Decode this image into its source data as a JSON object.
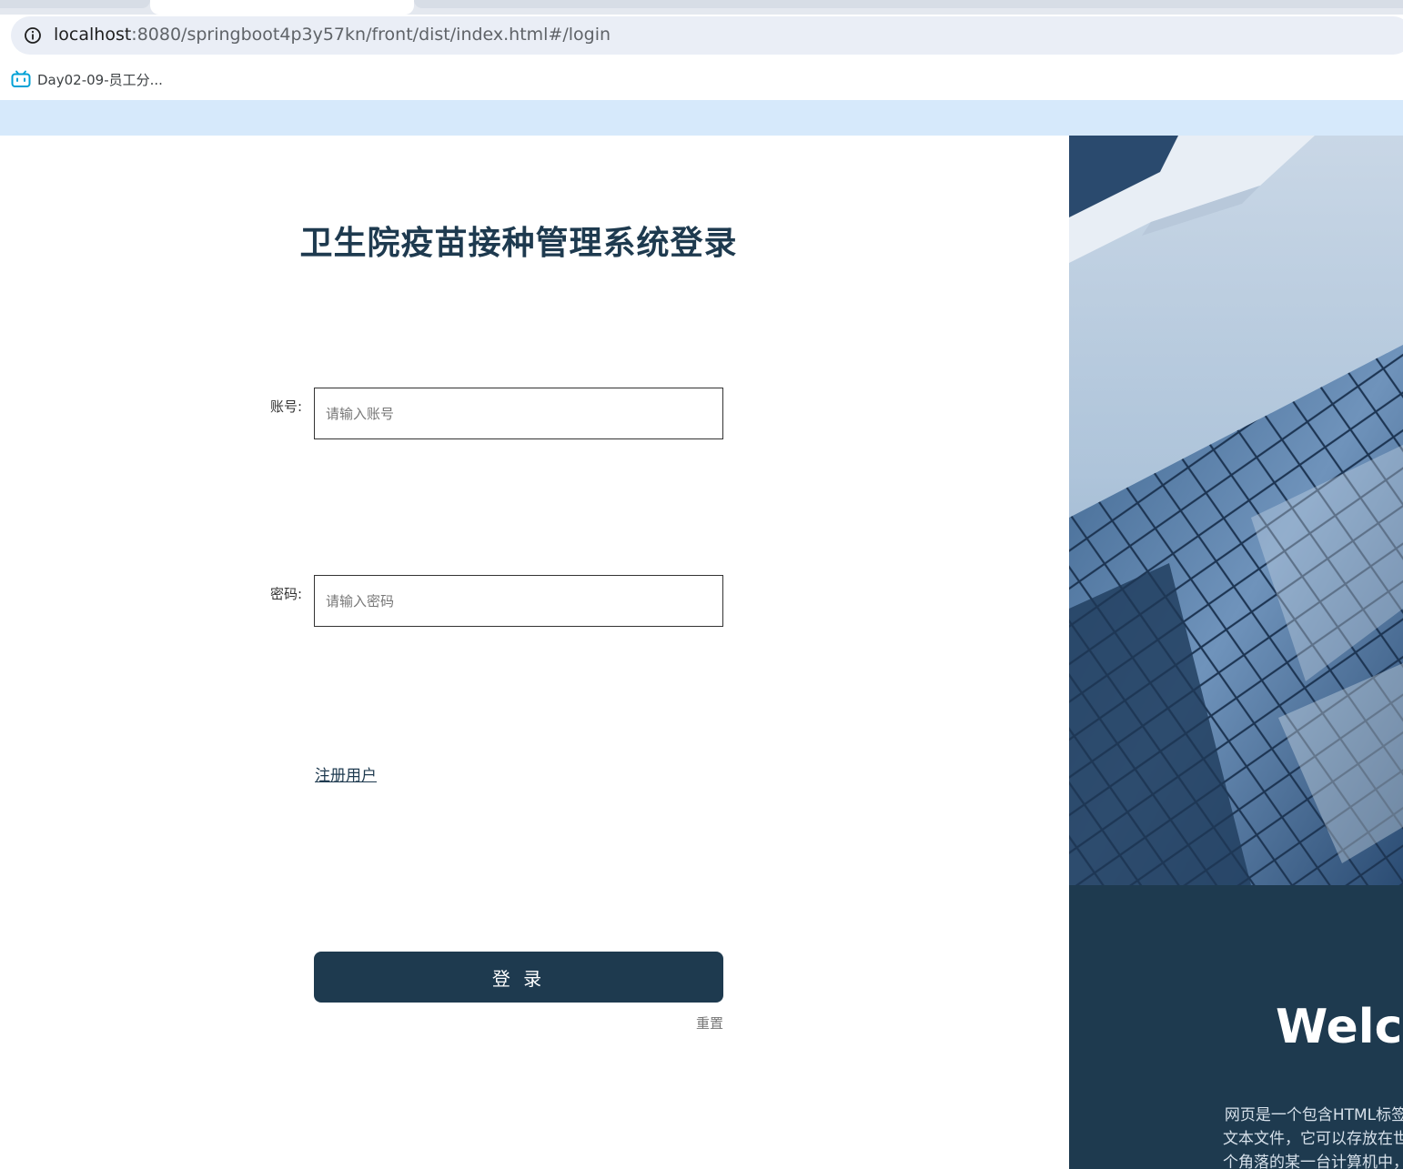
{
  "browser": {
    "url_host": "localhost",
    "url_path": ":8080/springboot4p3y57kn/front/dist/index.html#/login",
    "bookmark_label": "Day02-09-员工分...",
    "icons": {
      "site_info": "info-icon",
      "bookmark": "bilibili-icon"
    }
  },
  "login": {
    "title": "卫生院疫苗接种管理系统登录",
    "account_label": "账号:",
    "account_placeholder": "请输入账号",
    "password_label": "密码:",
    "password_placeholder": "请输入密码",
    "register_link": "注册用户",
    "login_button": "登 录",
    "reset_button": "重置"
  },
  "side_panel": {
    "welcome": "Welcome",
    "description": "网页是一个包含HTML标签的纯文本文件，它可以存放在世界某个角落的某一台计算机中，是万维网中的一"
  },
  "colors": {
    "primary": "#1e3a4f",
    "topbar": "#d6e9fb",
    "omnibox": "#eaeef6"
  }
}
